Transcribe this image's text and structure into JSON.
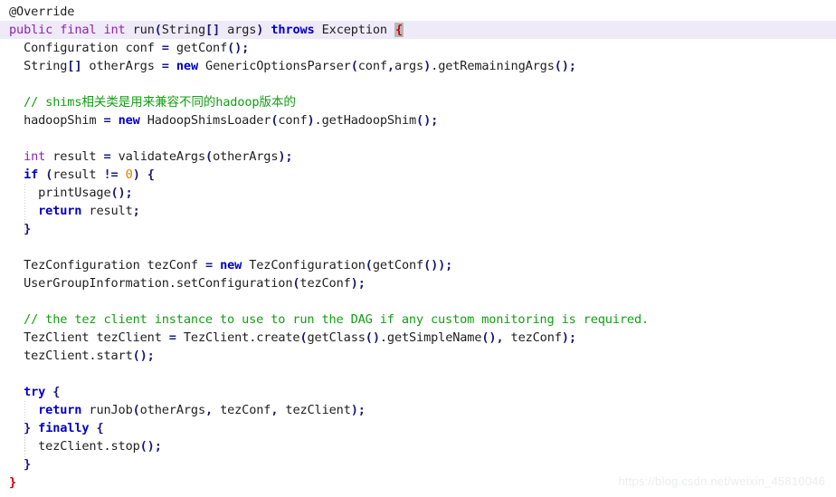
{
  "editor": {
    "language": "java",
    "background_color": "#ffffff",
    "current_line_highlight_color": "#eeeaf7",
    "bracket_match_color": "#b8b8b8",
    "font_size_px": 13.6,
    "line_height_px": 20
  },
  "theme": {
    "comment": "#12a012",
    "modifier_keyword": "#8f23b3",
    "control_keyword": "#0000c8",
    "punctuation": "#1a1a8c",
    "number_literal": "#e08000",
    "identifier": "#1f1f1f",
    "unmatched_brace": "#d00000"
  },
  "code": {
    "lines": [
      {
        "n": 1,
        "text": "@Override"
      },
      {
        "n": 2,
        "text": "public final int run(String[] args) throws Exception {"
      },
      {
        "n": 3,
        "text": "  Configuration conf = getConf();"
      },
      {
        "n": 4,
        "text": "  String[] otherArgs = new GenericOptionsParser(conf,args).getRemainingArgs();"
      },
      {
        "n": 5,
        "text": ""
      },
      {
        "n": 6,
        "text": "  // shims相关类是用来兼容不同的hadoop版本的"
      },
      {
        "n": 7,
        "text": "  hadoopShim = new HadoopShimsLoader(conf).getHadoopShim();"
      },
      {
        "n": 8,
        "text": ""
      },
      {
        "n": 9,
        "text": "  int result = validateArgs(otherArgs);"
      },
      {
        "n": 10,
        "text": "  if (result != 0) {"
      },
      {
        "n": 11,
        "text": "    printUsage();"
      },
      {
        "n": 12,
        "text": "    return result;"
      },
      {
        "n": 13,
        "text": "  }"
      },
      {
        "n": 14,
        "text": ""
      },
      {
        "n": 15,
        "text": "  TezConfiguration tezConf = new TezConfiguration(getConf());"
      },
      {
        "n": 16,
        "text": "  UserGroupInformation.setConfiguration(tezConf);"
      },
      {
        "n": 17,
        "text": ""
      },
      {
        "n": 18,
        "text": "  // the tez client instance to use to run the DAG if any custom monitoring is required."
      },
      {
        "n": 19,
        "text": "  TezClient tezClient = TezClient.create(getClass().getSimpleName(), tezConf);"
      },
      {
        "n": 20,
        "text": "  tezClient.start();"
      },
      {
        "n": 21,
        "text": ""
      },
      {
        "n": 22,
        "text": "  try {"
      },
      {
        "n": 23,
        "text": "    return runJob(otherArgs, tezConf, tezClient);"
      },
      {
        "n": 24,
        "text": "  } finally {"
      },
      {
        "n": 25,
        "text": "    tezClient.stop();"
      },
      {
        "n": 26,
        "text": "  }"
      },
      {
        "n": 27,
        "text": "}"
      }
    ]
  },
  "tokens": {
    "annotation_override": "@Override",
    "kw_public": "public",
    "kw_final": "final",
    "kw_int": "int",
    "kw_new": "new",
    "kw_throws": "throws",
    "kw_if": "if",
    "kw_return": "return",
    "kw_try": "try",
    "kw_finally": "finally",
    "literal_zero": "0",
    "type_string": "String",
    "type_exception": "Exception",
    "type_configuration": "Configuration",
    "type_tezconfiguration": "TezConfiguration",
    "type_tezclient": "TezClient",
    "type_usergroupinformation": "UserGroupInformation",
    "type_genericoptionsparser": "GenericOptionsParser",
    "type_hadoopshimsloader": "HadoopShimsLoader",
    "method_run": "run",
    "method_getconf": "getConf",
    "method_getremainingargs": "getRemainingArgs",
    "method_gethadoopshim": "getHadoopShim",
    "method_validateargs": "validateArgs",
    "method_printusage": "printUsage",
    "method_setconfiguration": "setConfiguration",
    "method_create": "create",
    "method_getclass": "getClass",
    "method_getsimplename": "getSimpleName",
    "method_start": "start",
    "method_runjob": "runJob",
    "method_stop": "stop",
    "var_conf": "conf",
    "var_args": "args",
    "var_otherargs": "otherArgs",
    "var_hadoopshim": "hadoopShim",
    "var_result": "result",
    "var_tezconf": "tezConf",
    "var_tezclient": "tezClient",
    "comment_shims": "// shims相关类是用来兼容不同的hadoop版本的",
    "comment_tezclient": "// the tez client instance to use to run the DAG if any custom monitoring is required."
  },
  "watermark": {
    "text": "https://blog.csdn.net/weixin_45810046"
  }
}
